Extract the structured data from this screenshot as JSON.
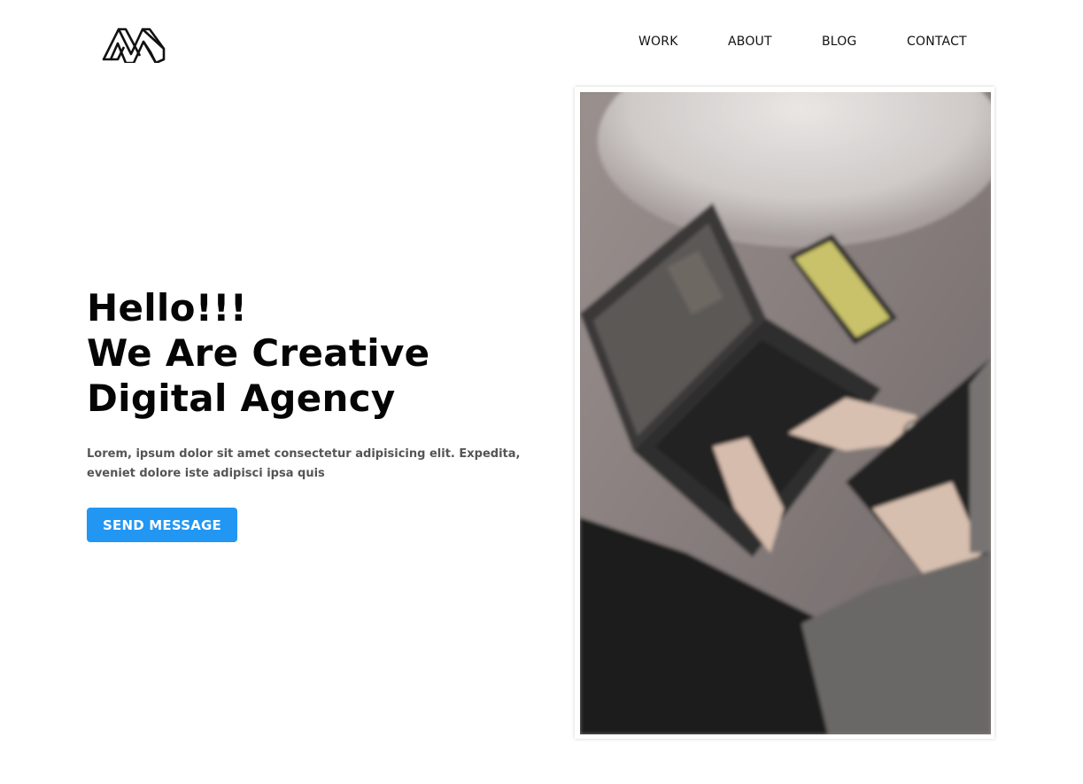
{
  "header": {
    "logo_icon": "stylized-m-logo-icon",
    "nav": [
      {
        "label": "WORK"
      },
      {
        "label": "ABOUT"
      },
      {
        "label": "BLOG"
      },
      {
        "label": "CONTACT"
      }
    ]
  },
  "hero": {
    "title_lines": [
      "Hello!!!",
      "We Are Creative",
      "Digital Agency"
    ],
    "description": "Lorem, ipsum dolor sit amet consectetur adipisicing elit. Expedita, eveniet dolore iste adipisci ipsa quis",
    "button_label": "SEND MESSAGE"
  },
  "photo": {
    "subject": "person-typing-on-laptop-photo"
  },
  "colors": {
    "accent": "#2196f3",
    "text": "#050505",
    "muted_text": "#555555",
    "background": "#ffffff"
  }
}
